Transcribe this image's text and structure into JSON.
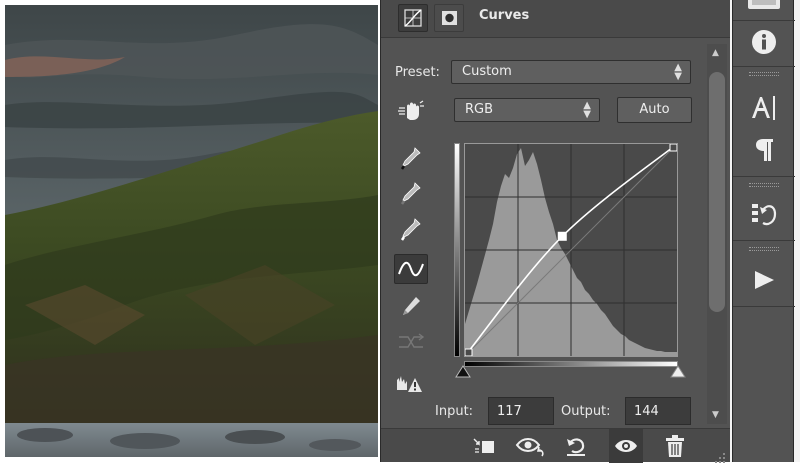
{
  "panel": {
    "title": "Curves",
    "preset_label": "Preset:",
    "preset_value": "Custom",
    "channel_value": "RGB",
    "auto_label": "Auto",
    "input_label": "Input:",
    "input_value": "117",
    "output_label": "Output:",
    "output_value": "144",
    "tools": [
      "on-image-adjust-hand-icon",
      "black-point-eyedropper-icon",
      "gray-point-eyedropper-icon",
      "white-point-eyedropper-icon",
      "curve-edit-points-icon",
      "pencil-draw-icon",
      "smooth-curve-icon",
      "clipping-warning-icon"
    ],
    "footer_icons": [
      "clip-to-layer-icon",
      "view-previous-state-icon",
      "reset-icon",
      "toggle-visibility-icon",
      "delete-icon"
    ],
    "curve_points": [
      [
        0,
        0
      ],
      [
        117,
        144
      ],
      [
        255,
        255
      ]
    ]
  },
  "dock": {
    "icons": [
      "collapse-icon",
      "info-icon",
      "character-icon",
      "paragraph-icon",
      "history-icon",
      "actions-play-icon"
    ]
  },
  "colors": {
    "panel_bg": "#535353",
    "dock_bg": "#535353",
    "graph_bg": "#4a4a4a",
    "histogram": "#9a9a9a"
  }
}
